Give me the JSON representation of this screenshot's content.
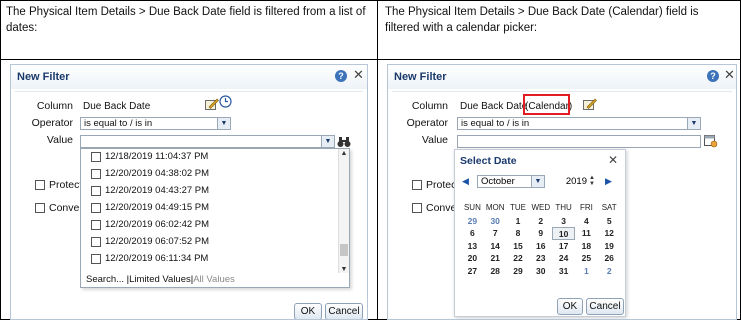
{
  "captions": {
    "left": "The Physical Item Details > Due Back Date field is filtered from a list of dates:",
    "right": "The Physical Item Details > Due Back Date (Calendar) field is filtered with a calendar picker:"
  },
  "left_dialog": {
    "title": "New Filter",
    "column_label": "Column",
    "column_value": "Due Back Date",
    "operator_label": "Operator",
    "operator_value": "is equal to / is in",
    "value_label": "Value",
    "value_value": "",
    "protect_label": "Protect F",
    "convert_label": "Convert",
    "options": [
      "12/18/2019 11:04:37 PM",
      "12/20/2019 04:38:02 PM",
      "12/20/2019 04:43:27 PM",
      "12/20/2019 04:49:15 PM",
      "12/20/2019 06:02:42 PM",
      "12/20/2019 06:07:52 PM",
      "12/20/2019 06:11:34 PM"
    ],
    "footer_search": "Search...",
    "footer_limited": "Limited Values",
    "footer_all": "All Values",
    "ok_label": "OK",
    "cancel_label": "Cancel"
  },
  "right_dialog": {
    "title": "New Filter",
    "column_label": "Column",
    "column_value": "Due Back Date",
    "column_highlight": "(Calendar)",
    "operator_label": "Operator",
    "operator_value": "is equal to / is in",
    "value_label": "Value",
    "protect_label": "Protect",
    "convert_label": "Conver",
    "calendar": {
      "title": "Select Date",
      "month": "October",
      "year": "2019",
      "weekdays": [
        "SUN",
        "MON",
        "TUE",
        "WED",
        "THU",
        "FRI",
        "SAT"
      ],
      "weeks": [
        [
          "29",
          "30",
          "1",
          "2",
          "3",
          "4",
          "5"
        ],
        [
          "6",
          "7",
          "8",
          "9",
          "10",
          "11",
          "12"
        ],
        [
          "13",
          "14",
          "15",
          "16",
          "17",
          "18",
          "19"
        ],
        [
          "20",
          "21",
          "22",
          "23",
          "24",
          "25",
          "26"
        ],
        [
          "27",
          "28",
          "29",
          "30",
          "31",
          "1",
          "2"
        ]
      ],
      "today": "10"
    },
    "ok_label": "OK",
    "cancel_label": "Cancel"
  },
  "colors": {
    "title_blue": "#1b3a6b",
    "highlight_red": "#e31b23",
    "muted_day": "#5a7db5"
  }
}
